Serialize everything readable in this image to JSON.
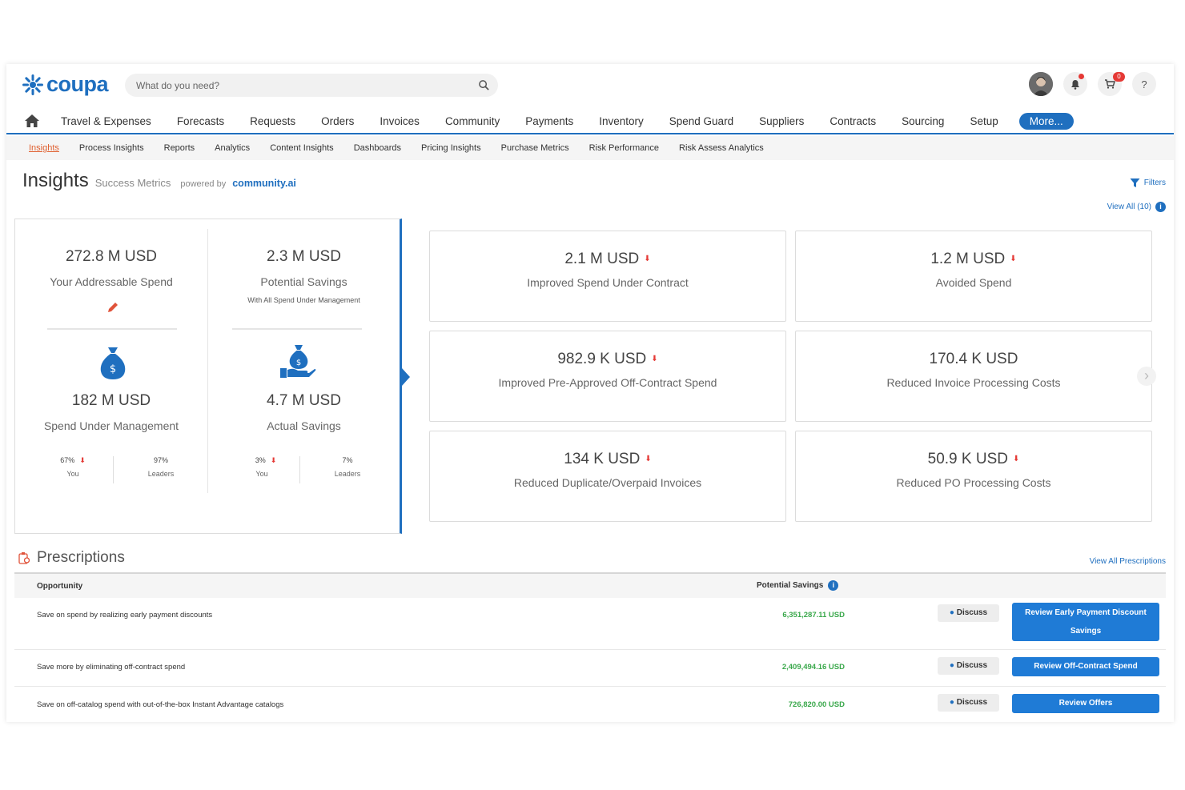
{
  "header": {
    "logo_text": "coupa",
    "search_placeholder": "What do you need?",
    "cart_count": "0",
    "help_label": "?"
  },
  "main_nav": [
    "Travel & Expenses",
    "Forecasts",
    "Requests",
    "Orders",
    "Invoices",
    "Community",
    "Payments",
    "Inventory",
    "Spend Guard",
    "Suppliers",
    "Contracts",
    "Sourcing",
    "Setup"
  ],
  "main_nav_more": "More...",
  "sub_nav": [
    "Insights",
    "Process Insights",
    "Reports",
    "Analytics",
    "Content Insights",
    "Dashboards",
    "Pricing Insights",
    "Purchase Metrics",
    "Risk Performance",
    "Risk Assess Analytics"
  ],
  "page": {
    "title": "Insights",
    "subtitle": "Success Metrics",
    "powered_by": "powered by",
    "powered_brand": "community.ai",
    "filters_label": "Filters",
    "view_all_label": "View All (10)"
  },
  "summary": {
    "addressable_value": "272.8 M USD",
    "addressable_label": "Your Addressable Spend",
    "potential_value": "2.3 M USD",
    "potential_label": "Potential Savings",
    "potential_sub": "With All Spend Under Management",
    "sum_value": "182 M USD",
    "sum_label": "Spend Under Management",
    "sum_you": "67%",
    "sum_you_label": "You",
    "sum_leaders": "97%",
    "sum_leaders_label": "Leaders",
    "actual_value": "4.7 M USD",
    "actual_label": "Actual Savings",
    "actual_you": "3%",
    "actual_you_label": "You",
    "actual_leaders": "7%",
    "actual_leaders_label": "Leaders"
  },
  "cards": [
    {
      "value": "2.1 M USD",
      "label": "Improved Spend Under Contract"
    },
    {
      "value": "1.2 M USD",
      "label": "Avoided Spend"
    },
    {
      "value": "982.9 K USD",
      "label": "Improved Pre-Approved Off-Contract Spend"
    },
    {
      "value": "170.4 K USD",
      "label": "Reduced Invoice Processing Costs"
    },
    {
      "value": "134 K USD",
      "label": "Reduced Duplicate/Overpaid Invoices"
    },
    {
      "value": "50.9 K USD",
      "label": "Reduced PO Processing Costs"
    }
  ],
  "prescriptions": {
    "title": "Prescriptions",
    "view_all": "View All Prescriptions",
    "col_opportunity": "Opportunity",
    "col_savings": "Potential Savings",
    "discuss_label": "Discuss",
    "rows": [
      {
        "opportunity": "Save on spend by realizing early payment discounts",
        "savings": "6,351,287.11 USD",
        "action": "Review Early Payment Discount Savings"
      },
      {
        "opportunity": "Save more by eliminating off-contract spend",
        "savings": "2,409,494.16 USD",
        "action": "Review Off-Contract Spend"
      },
      {
        "opportunity": "Save on off-catalog spend with out-of-the-box Instant Advantage catalogs",
        "savings": "726,820.00 USD",
        "action": "Review Offers"
      }
    ]
  }
}
